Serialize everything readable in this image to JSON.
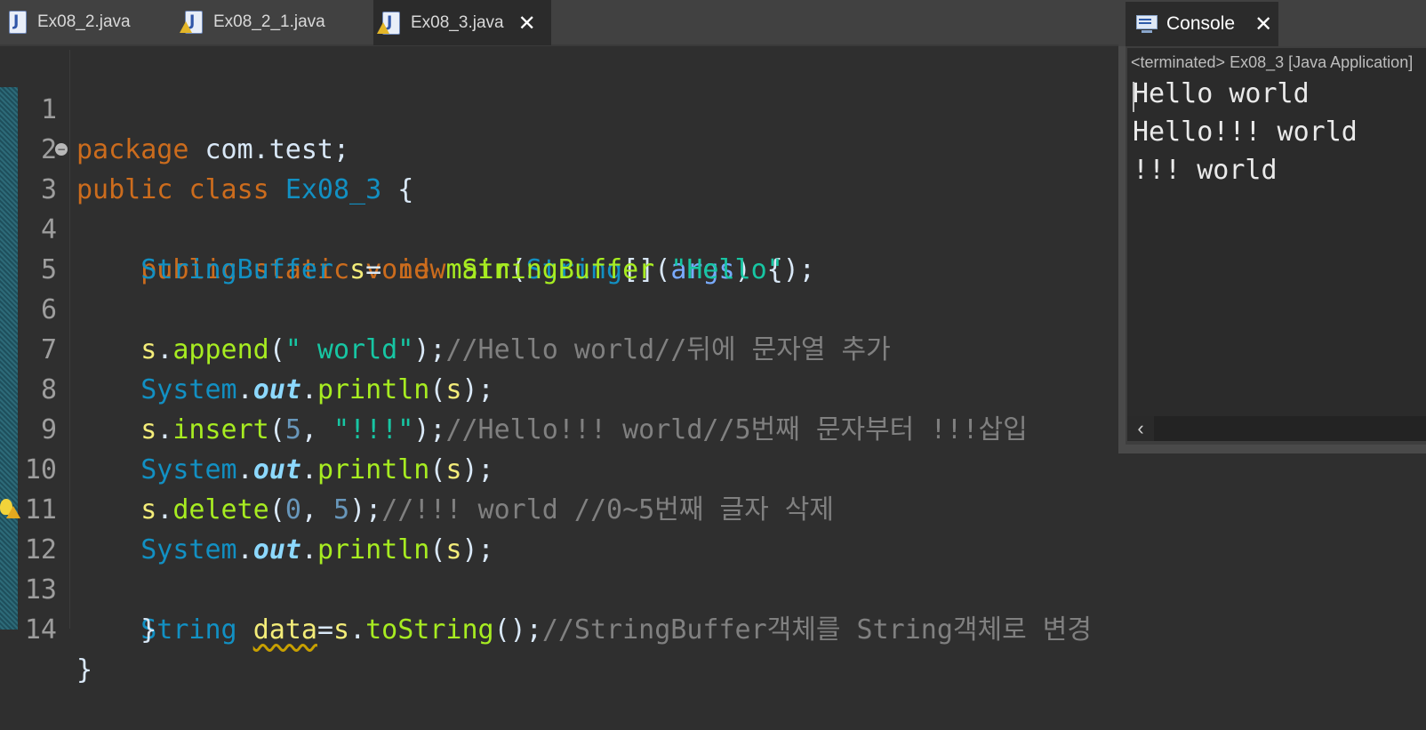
{
  "editor": {
    "tabs": [
      {
        "label": "Ex08_2.java",
        "warning": false,
        "active": false
      },
      {
        "label": "Ex08_2_1.java",
        "warning": true,
        "active": false
      },
      {
        "label": "Ex08_3.java",
        "warning": true,
        "active": true
      }
    ],
    "close_glyph": "✕",
    "lines": [
      {
        "n": "1"
      },
      {
        "n": "2"
      },
      {
        "n": "3"
      },
      {
        "n": "4"
      },
      {
        "n": "5"
      },
      {
        "n": "6"
      },
      {
        "n": "7"
      },
      {
        "n": "8"
      },
      {
        "n": "9"
      },
      {
        "n": "10"
      },
      {
        "n": "11"
      },
      {
        "n": "12"
      },
      {
        "n": "13"
      },
      {
        "n": "14"
      }
    ],
    "code": {
      "l1": {
        "kw": "package",
        "rest": " com.test;"
      },
      "l2": {
        "kw1": "public",
        "kw2": "class",
        "cls": "Ex08_3",
        "rest": " {"
      },
      "l3": {
        "kw1": "public",
        "kw2": "static",
        "kw3": "void",
        "fn": "main",
        "p1": "(",
        "ty": "String",
        "p2": "[] ",
        "arg": "args",
        "p3": ") {"
      },
      "l4": {
        "ty1": "StringBuffer",
        "var": "s",
        "op": "= ",
        "kw": "new",
        "ty2": "StringBuffer",
        "p1": "(",
        "str": "\"Hello\"",
        "p2": ");"
      },
      "l6": {
        "var": "s",
        "dot": ".",
        "fn": "append",
        "p1": "(",
        "str": "\" world\"",
        "p2": ");",
        "cm": "//Hello world//뒤에 문자열 추가"
      },
      "l7": {
        "ty": "System",
        "dot1": ".",
        "fd": "out",
        "dot2": ".",
        "fn": "println",
        "p1": "(",
        "var": "s",
        "p2": ");"
      },
      "l8": {
        "var": "s",
        "dot": ".",
        "fn": "insert",
        "p1": "(",
        "num": "5",
        "comma": ", ",
        "str": "\"!!!\"",
        "p2": ");",
        "cm": "//Hello!!! world//5번째 문자부터 !!!삽입"
      },
      "l9": {
        "ty": "System",
        "dot1": ".",
        "fd": "out",
        "dot2": ".",
        "fn": "println",
        "p1": "(",
        "var": "s",
        "p2": ");"
      },
      "l10": {
        "var": "s",
        "dot": ".",
        "fn": "delete",
        "p1": "(",
        "num1": "0",
        "comma": ", ",
        "num2": "5",
        "p2": ");",
        "cm": "//!!! world //0~5번째 글자 삭제"
      },
      "l11": {
        "ty": "System",
        "dot1": ".",
        "fd": "out",
        "dot2": ".",
        "fn": "println",
        "p1": "(",
        "var": "s",
        "p2": ");"
      },
      "l12": {
        "ty": "String",
        "var": "data",
        "op": "=",
        "var2": "s",
        "dot": ".",
        "fn": "toString",
        "p2": "();",
        "cm": "//StringBuffer객체를 String객체로 변경"
      },
      "l13": {
        "brace": "}"
      },
      "l14": {
        "brace": "}"
      }
    }
  },
  "console": {
    "tab_label": "Console",
    "status": "<terminated> Ex08_3 [Java Application]",
    "output": [
      "Hello world",
      "Hello!!! world",
      "!!! world"
    ],
    "scroll_left_glyph": "‹"
  }
}
